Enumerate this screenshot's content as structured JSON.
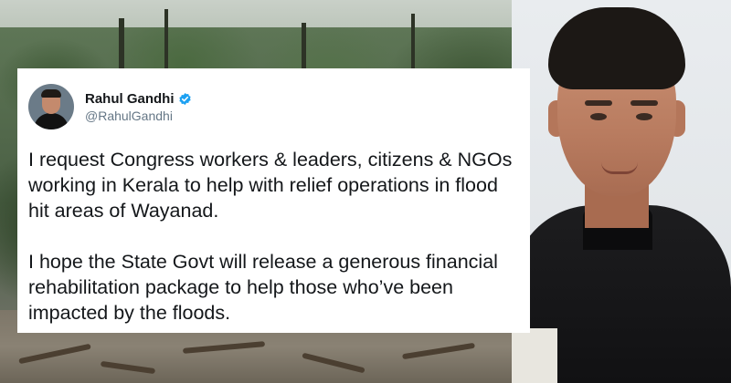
{
  "tweet": {
    "display_name": "Rahul Gandhi",
    "handle": "@RahulGandhi",
    "verified": true,
    "paragraphs": [
      "I request Congress workers & leaders, citizens & NGOs working in Kerala to help with relief operations in flood hit areas of Wayanad.",
      "I hope the State Govt will release a generous financial rehabilitation package to help those who’ve been impacted by the floods."
    ]
  },
  "colors": {
    "verified_badge": "#1da1f2",
    "card_background": "#ffffff",
    "text": "#14171a",
    "handle_text": "#657786"
  },
  "icons": {
    "verified": "verified-badge-icon"
  }
}
